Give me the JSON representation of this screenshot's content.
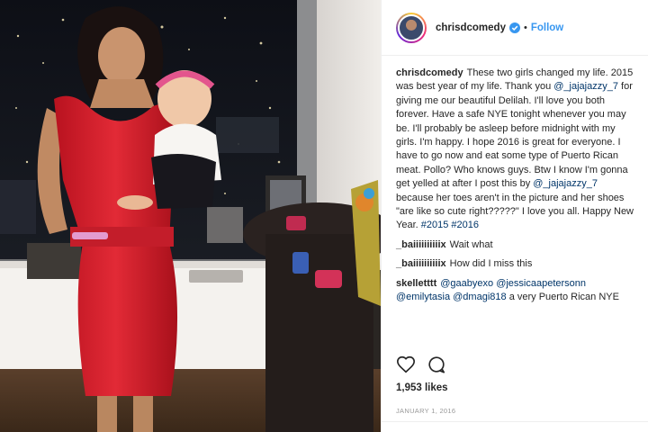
{
  "post": {
    "username": "chrisdcomedy",
    "follow_label": "Follow",
    "separator": "•",
    "likes": "1,953 likes",
    "date": "JANUARY 1, 2016"
  },
  "caption": {
    "user": "chrisdcomedy",
    "parts": [
      "These two girls changed my life. 2015 was best year of my life. Thank you ",
      "@_jajajazzy_7",
      " for giving me our beautiful Delilah. I'll love you both forever. Have a safe NYE tonight whenever you may be. I'll probably be asleep before midnight with my girls. I'm happy. I hope 2016 is great for everyone. I have to go now and eat some type of Puerto Rican meat. Pollo? Who knows guys. Btw I know I'm gonna get yelled at after I post this by ",
      "@_jajajazzy_7",
      " because her toes aren't in the picture and her shoes \"are like so cute right?????\" I love you all. Happy New Year. ",
      "#2015",
      " ",
      "#2016"
    ]
  },
  "comments": [
    {
      "user": "_baiiiiiiiiiix",
      "text": "Wait what"
    },
    {
      "user": "_baiiiiiiiiiix",
      "text": "How did I miss this"
    },
    {
      "user": "skelletttt",
      "mentions": [
        "@gaabyexo",
        "@jessicaapetersonn",
        "@emilytasia",
        "@dmagi818"
      ],
      "text": "a very Puerto Rican NYE"
    }
  ],
  "icons": {
    "like": "heart-icon",
    "comment": "comment-icon",
    "verified": "verified-badge-icon"
  },
  "colors": {
    "link": "#3897f0",
    "mention": "#003569",
    "dress": "#d9222e"
  }
}
